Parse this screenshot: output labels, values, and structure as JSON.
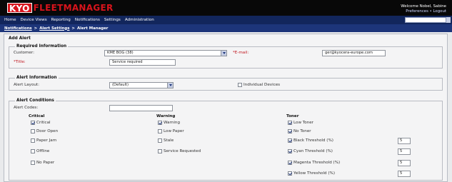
{
  "header": {
    "logo_kyo": "KYO",
    "logo_fleet": "FLEETMANAGER",
    "welcome": "Welcome Nobel, Sabine",
    "pref_links": "Preferences • Logout"
  },
  "nav": {
    "items": [
      "Home",
      "Device Views",
      "Reporting",
      "Notifications",
      "Settings",
      "Administration"
    ],
    "search_value": ""
  },
  "breadcrumb": {
    "items": [
      "Notifications",
      "Alert Settings",
      "Alert Manager"
    ],
    "separator": ">"
  },
  "page_title": "Add Alert",
  "required_info": {
    "legend": "Required Information",
    "customer_label": "Customer:",
    "customer_value": "KME BOG (38)",
    "email_label": "*E-mail:",
    "email_value": "ger@kyocera-europe.com",
    "title_label": "*Title:",
    "title_value": "Service required"
  },
  "alert_info": {
    "legend": "Alert Information",
    "layout_label": "Alert Layout:",
    "layout_value": "(Default)",
    "individual_label": "Individual Devices"
  },
  "alert_conditions": {
    "legend": "Alert Conditions",
    "codes_label": "Alert Codes:",
    "codes_value": "",
    "critical": {
      "title": "Critical",
      "items": [
        {
          "label": "Critical",
          "checked": true
        },
        {
          "label": "Door Open",
          "checked": false
        },
        {
          "label": "Paper Jam",
          "checked": false
        },
        {
          "label": "Offline",
          "checked": false
        },
        {
          "label": "No Paper",
          "checked": false
        }
      ]
    },
    "warning": {
      "title": "Warning",
      "items": [
        {
          "label": "Warning",
          "checked": true
        },
        {
          "label": "Low Paper",
          "checked": false
        },
        {
          "label": "Stale",
          "checked": false
        },
        {
          "label": "Service Requested",
          "checked": false
        }
      ]
    },
    "toner": {
      "title": "Toner",
      "items": [
        {
          "label": "Low Toner",
          "checked": true
        },
        {
          "label": "No Toner",
          "checked": true
        },
        {
          "label": "Black Threshold (%)",
          "checked": true,
          "value": "5"
        },
        {
          "label": "Cyan Threshold (%)",
          "checked": true,
          "value": "5"
        },
        {
          "label": "Magenta Threshold (%)",
          "checked": true,
          "value": "5"
        },
        {
          "label": "Yellow Threshold (%)",
          "checked": true,
          "value": "5"
        }
      ]
    }
  },
  "colors": {
    "header_bg": "#080808",
    "brand_red": "#d8141c",
    "nav_bg": "#12265c",
    "crumb_bg": "#1d357a"
  }
}
